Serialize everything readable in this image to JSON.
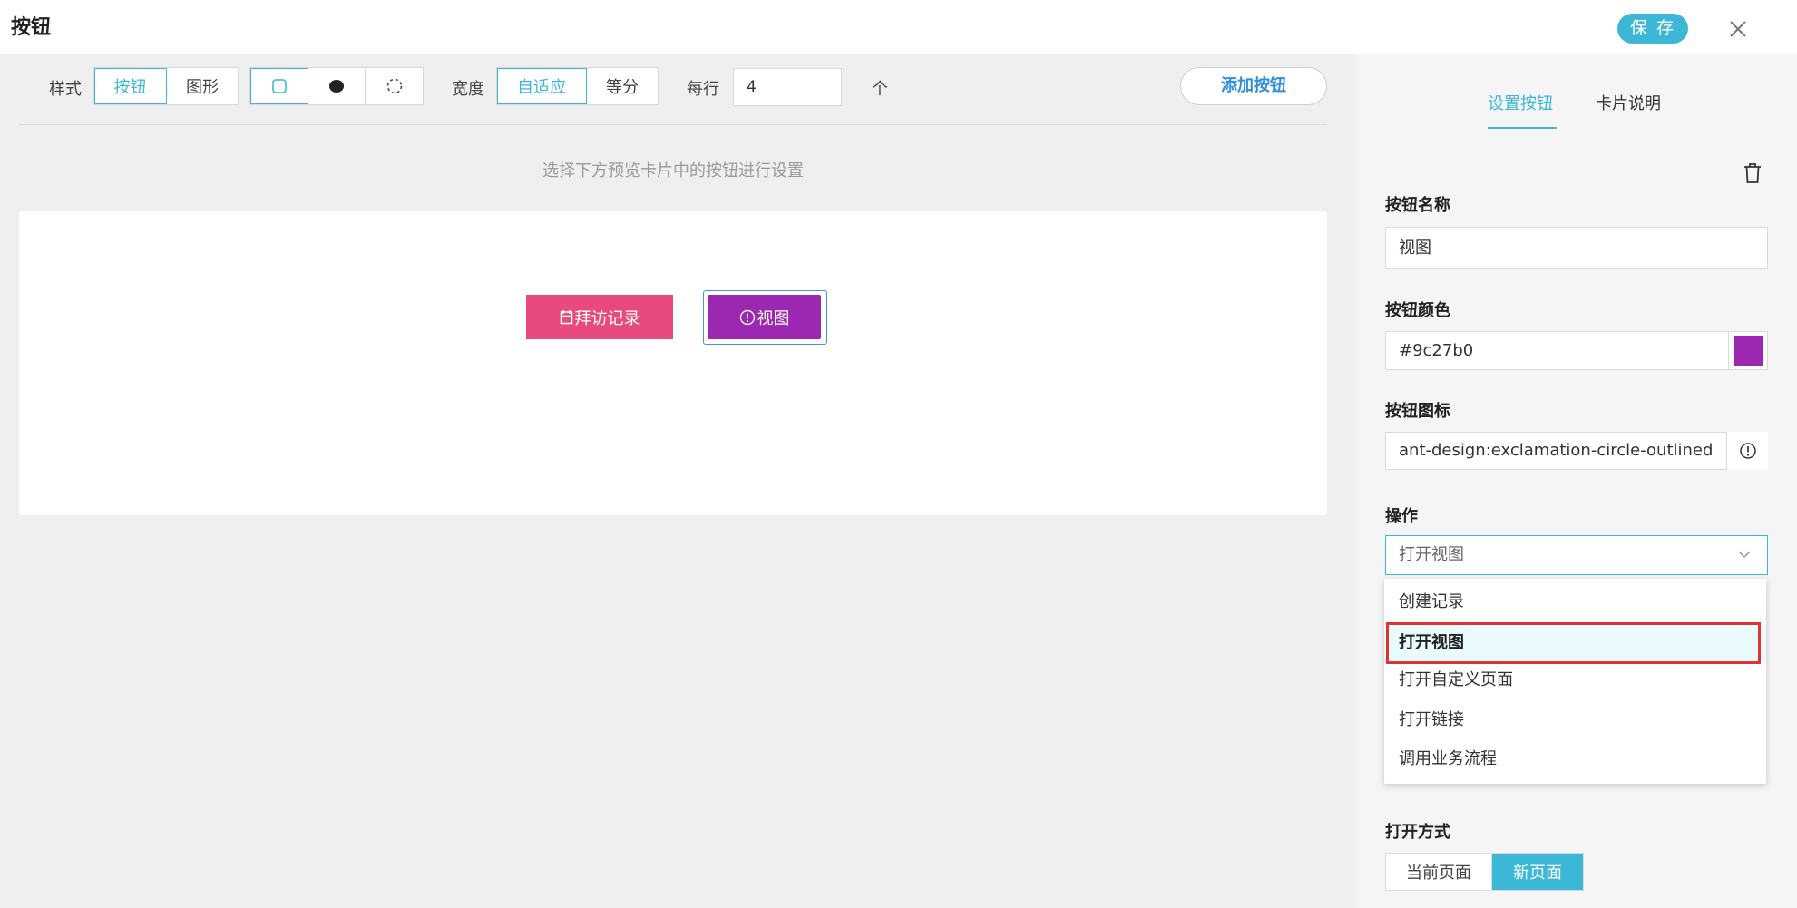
{
  "header": {
    "title": "按钮",
    "save_label": "保 存"
  },
  "toolbar": {
    "style_label": "样式",
    "style_options": [
      "按钮",
      "图形"
    ],
    "width_label": "宽度",
    "width_options": [
      "自适应",
      "等分"
    ],
    "per_row_label": "每行",
    "per_row_value": "4",
    "per_row_unit": "个",
    "add_button_label": "添加按钮"
  },
  "preview": {
    "hint": "选择下方预览卡片中的按钮进行设置",
    "buttons": [
      {
        "label": "拜访记录",
        "color": "#e84a7e",
        "icon": "calendar-icon"
      },
      {
        "label": "视图",
        "color": "#9c27b0",
        "icon": "exclamation-circle-icon"
      }
    ]
  },
  "panel": {
    "tabs": [
      "设置按钮",
      "卡片说明"
    ],
    "name_label": "按钮名称",
    "name_value": "视图",
    "color_label": "按钮颜色",
    "color_value": "#9c27b0",
    "icon_label": "按钮图标",
    "icon_value": "ant-design:exclamation-circle-outlined",
    "action_label": "操作",
    "action_value": "打开视图",
    "action_options": [
      "创建记录",
      "打开视图",
      "打开自定义页面",
      "打开链接",
      "调用业务流程"
    ],
    "open_mode_label": "打开方式",
    "open_mode_options": [
      "当前页面",
      "新页面"
    ]
  }
}
